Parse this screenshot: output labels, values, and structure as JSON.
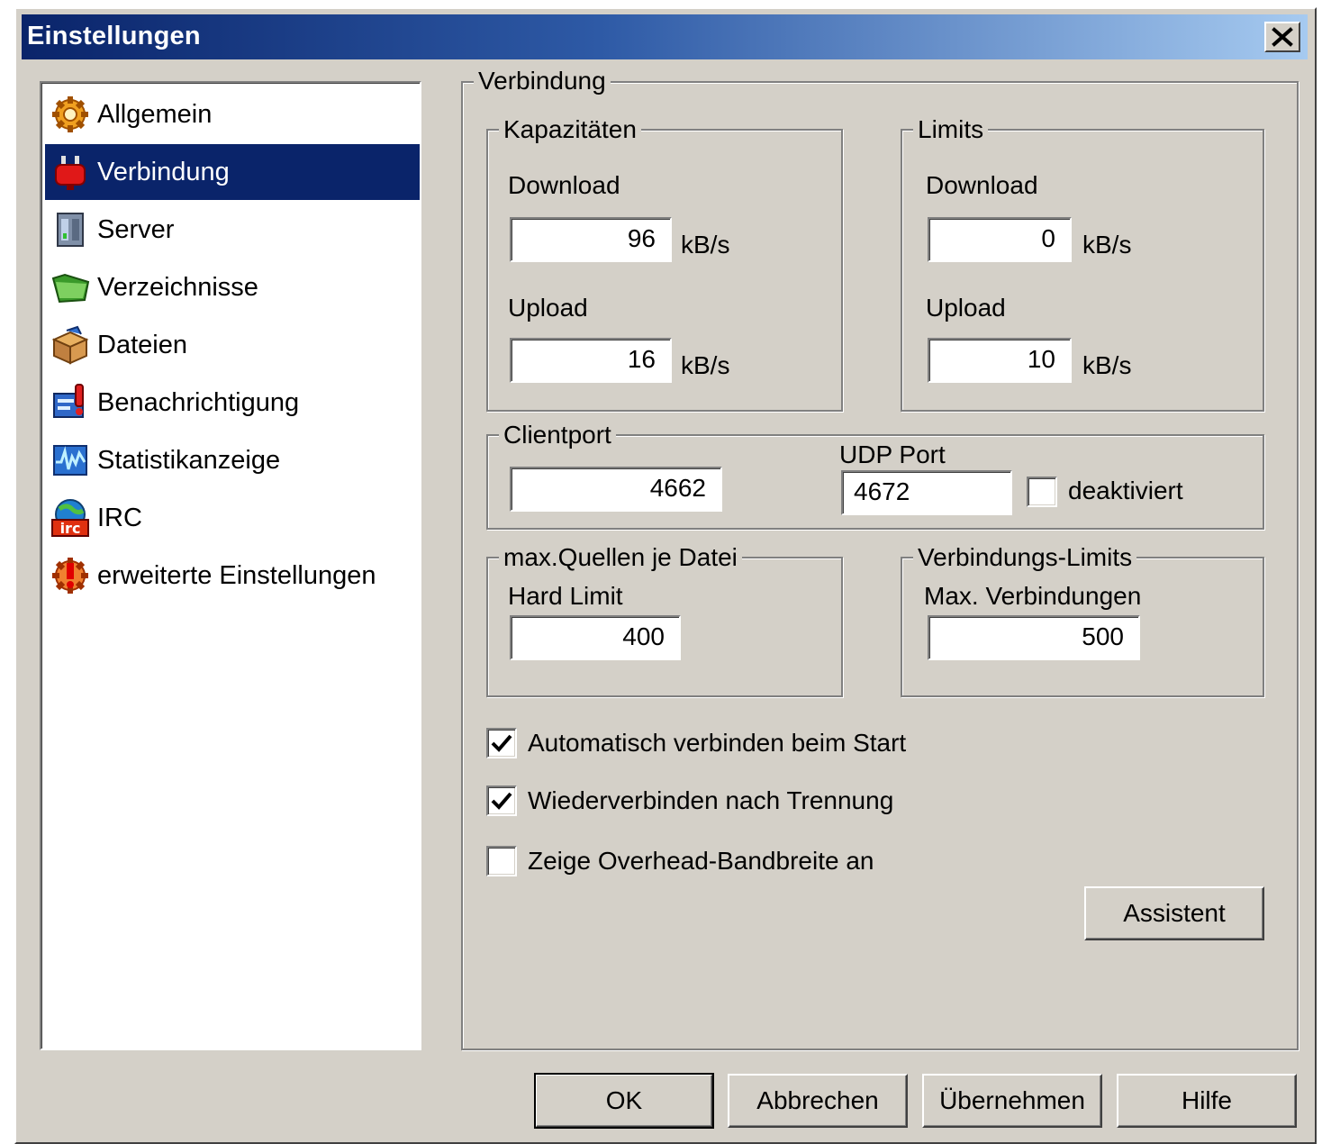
{
  "window": {
    "title": "Einstellungen",
    "close_symbol": "✕"
  },
  "sidebar": {
    "items": [
      {
        "label": "Allgemein",
        "icon": "gear-icon"
      },
      {
        "label": "Verbindung",
        "icon": "plug-icon",
        "selected": true
      },
      {
        "label": "Server",
        "icon": "server-icon"
      },
      {
        "label": "Verzeichnisse",
        "icon": "folder-icon"
      },
      {
        "label": "Dateien",
        "icon": "box-icon"
      },
      {
        "label": "Benachrichtigung",
        "icon": "notification-icon"
      },
      {
        "label": "Statistikanzeige",
        "icon": "statistics-icon"
      },
      {
        "label": "IRC",
        "icon": "irc-icon"
      },
      {
        "label": "erweiterte Einstellungen",
        "icon": "warning-gear-icon"
      }
    ]
  },
  "panel": {
    "title": "Verbindung",
    "capacities": {
      "title": "Kapazitäten",
      "download_label": "Download",
      "download_value": "96",
      "upload_label": "Upload",
      "upload_value": "16",
      "unit": "kB/s"
    },
    "limits": {
      "title": "Limits",
      "download_label": "Download",
      "download_value": "0",
      "upload_label": "Upload",
      "upload_value": "10",
      "unit": "kB/s"
    },
    "clientport": {
      "title": "Clientport",
      "tcp_value": "4662",
      "udp_label": "UDP Port",
      "udp_value": "4672",
      "disabled_label": "deaktiviert",
      "disabled_checked": false
    },
    "max_sources": {
      "title": "max.Quellen je Datei",
      "hard_limit_label": "Hard Limit",
      "hard_limit_value": "400"
    },
    "connection_limits": {
      "title": "Verbindungs-Limits",
      "max_connections_label": "Max. Verbindungen",
      "max_connections_value": "500"
    },
    "options": [
      {
        "label": "Automatisch verbinden beim Start",
        "checked": true
      },
      {
        "label": "Wiederverbinden nach Trennung",
        "checked": true
      },
      {
        "label": "Zeige Overhead-Bandbreite an",
        "checked": false
      }
    ],
    "wizard_button": "Assistent"
  },
  "footer": {
    "ok": "OK",
    "cancel": "Abbrechen",
    "apply": "Übernehmen",
    "help": "Hilfe"
  },
  "colors": {
    "dialog_bg": "#d4d0c8",
    "selection": "#0a246a",
    "title_gradient_start": "#0a246a",
    "title_gradient_end": "#a6caf0"
  }
}
